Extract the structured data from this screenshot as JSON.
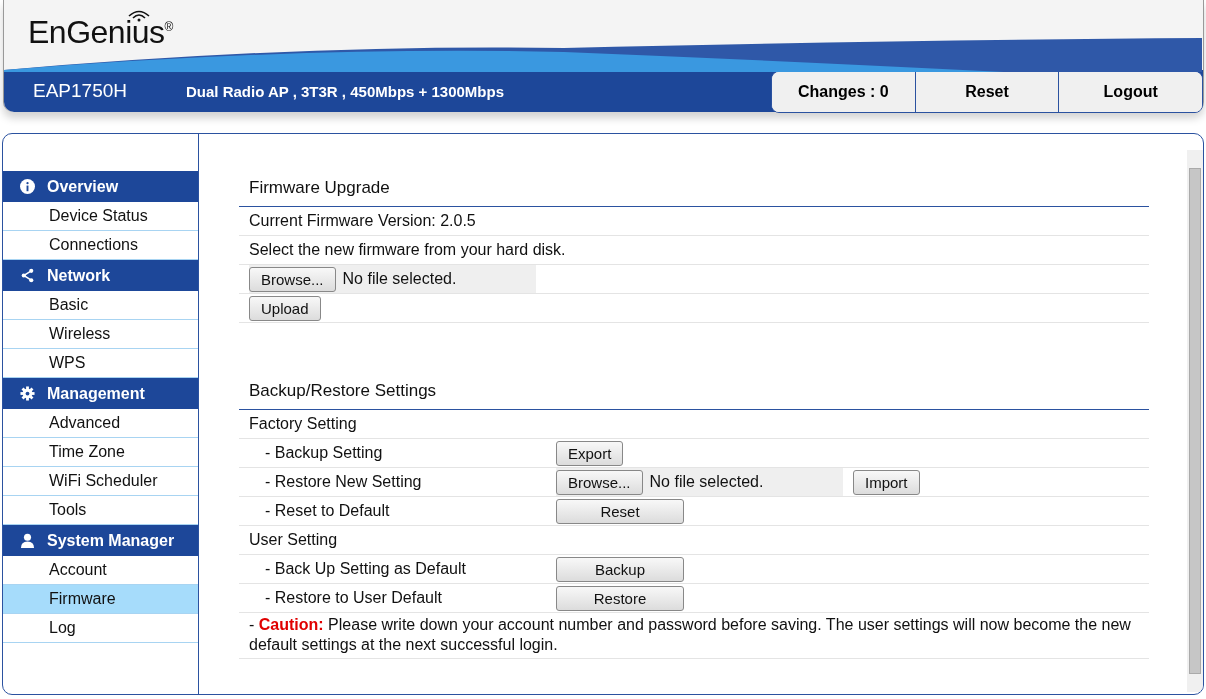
{
  "header": {
    "logo": "EnGenius",
    "logo_mark": "®",
    "model": "EAP1750H",
    "description": "Dual Radio AP , 3T3R , 450Mbps + 1300Mbps",
    "buttons": [
      "Changes : 0",
      "Reset",
      "Logout"
    ]
  },
  "sidebar": {
    "groups": [
      {
        "label": "Overview",
        "items": [
          {
            "label": "Device Status",
            "selected": false
          },
          {
            "label": "Connections",
            "selected": false
          }
        ]
      },
      {
        "label": "Network",
        "items": [
          {
            "label": "Basic",
            "selected": false
          },
          {
            "label": "Wireless",
            "selected": false
          },
          {
            "label": "WPS",
            "selected": false
          }
        ]
      },
      {
        "label": "Management",
        "items": [
          {
            "label": "Advanced",
            "selected": false
          },
          {
            "label": "Time Zone",
            "selected": false
          },
          {
            "label": "WiFi Scheduler",
            "selected": false
          },
          {
            "label": "Tools",
            "selected": false
          }
        ]
      },
      {
        "label": "System Manager",
        "items": [
          {
            "label": "Account",
            "selected": false
          },
          {
            "label": "Firmware",
            "selected": true
          },
          {
            "label": "Log",
            "selected": false
          }
        ]
      }
    ]
  },
  "firmware_upgrade": {
    "title": "Firmware Upgrade",
    "version": "Current Firmware Version: 2.0.5",
    "instruction": "Select the new firmware from your hard disk.",
    "browse": "Browse...",
    "file": "No file selected.",
    "upload": "Upload"
  },
  "backup_restore": {
    "title": "Backup/Restore Settings",
    "rows": [
      {
        "kind": "heading",
        "label": "Factory Setting"
      },
      {
        "kind": "button",
        "label": "- Backup Setting",
        "button": "Export"
      },
      {
        "kind": "file",
        "label": "- Restore New Setting",
        "browse": "Browse...",
        "file": "No file selected.",
        "button": "Import"
      },
      {
        "kind": "wide",
        "label": "- Reset to Default",
        "button": "Reset"
      },
      {
        "kind": "heading",
        "label": "User Setting"
      },
      {
        "kind": "wide",
        "label": "- Back Up Setting as Default",
        "button": "Backup"
      },
      {
        "kind": "wide",
        "label": "- Restore to User Default",
        "button": "Restore"
      }
    ],
    "caution": "- **Caution:**  Please write down your account number and password before saving. The user settings will now become the new default settings at the next successful login."
  }
}
